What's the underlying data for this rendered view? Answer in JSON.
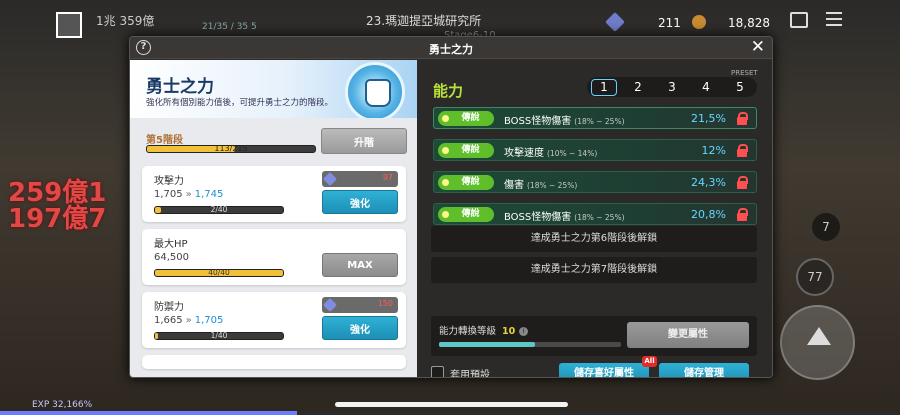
{
  "hud": {
    "level_text": "1兆 359億",
    "map_name": "23.瑪迦提亞城研究所",
    "stage_text": "Stage6-10",
    "kill_count": "21/35 / 35 5",
    "cube_count": "211",
    "gold_count": "18,828",
    "damage_line1": "259億1",
    "damage_line2": "197億7",
    "exp_label": "EXP 32,166%",
    "side_count_7": "7",
    "side_count_77": "77"
  },
  "dialog": {
    "title": "勇士之力",
    "help_symbol": "?",
    "close_symbol": "✕"
  },
  "left": {
    "banner_title": "勇士之力",
    "banner_subtitle": "強化所有個別能力值後，可提升勇士之力的階段。",
    "stage_label": "第5階段",
    "stage_progress": "113/215",
    "stage_progress_fraction": 0.526,
    "upgrade_label": "升階",
    "stats": [
      {
        "name": "攻擊力",
        "current": "1,705",
        "next": "1,745",
        "progress": "2/40",
        "progress_fraction": 0.05,
        "cost": "97",
        "action": "強化",
        "action_style": "blue"
      },
      {
        "name": "最大HP",
        "current": "64,500",
        "next": "",
        "progress": "40/40",
        "progress_fraction": 1.0,
        "cost": "",
        "action": "MAX",
        "action_style": "gray"
      },
      {
        "name": "防禦力",
        "current": "1,665",
        "next": "1,705",
        "progress": "1/40",
        "progress_fraction": 0.025,
        "cost": "150",
        "action": "強化",
        "action_style": "blue"
      }
    ],
    "arrow_symbol": "»"
  },
  "right": {
    "ability_title": "能力",
    "preset_label": "PRESET",
    "presets": [
      "1",
      "2",
      "3",
      "4",
      "5"
    ],
    "active_preset": "1",
    "abilities": [
      {
        "tier": "傳說",
        "name": "BOSS怪物傷害",
        "range": "(18% ~ 25%)",
        "value": "21,5%"
      },
      {
        "tier": "傳說",
        "name": "攻擊速度",
        "range": "(10% ~ 14%)",
        "value": "12%"
      },
      {
        "tier": "傳說",
        "name": "傷害",
        "range": "(18% ~ 25%)",
        "value": "24,3%"
      },
      {
        "tier": "傳說",
        "name": "BOSS怪物傷害",
        "range": "(18% ~ 25%)",
        "value": "20,8%"
      }
    ],
    "unlock_6": "達成勇士之力第6階段後解鎖",
    "unlock_7": "達成勇士之力第7階段後解鎖",
    "change_level_label": "能力轉換等級",
    "change_level_value": "10",
    "change_progress_fraction": 0.53,
    "info_symbol": "i",
    "change_button": "變更屬性",
    "use_preset_label": "套用預設",
    "save_favorite_button": "儲存喜好屬性",
    "all_badge": "All",
    "save_manage_button": "儲存管理"
  }
}
